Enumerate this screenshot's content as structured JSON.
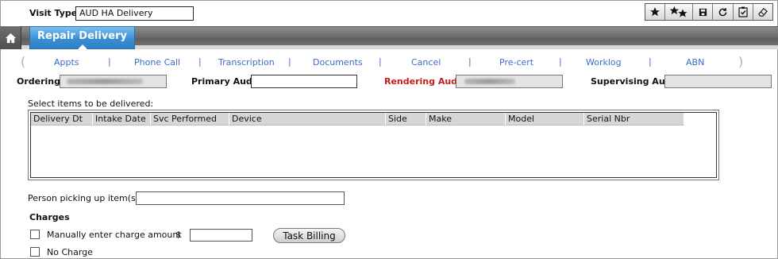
{
  "visit": {
    "type_label": "Visit Type:",
    "type_value": "AUD HA Delivery"
  },
  "toolbar": {
    "buttons": [
      {
        "icon": "star-icon"
      },
      {
        "icon": "two-stars-icon"
      },
      {
        "icon": "save-icon"
      },
      {
        "icon": "refresh-icon"
      },
      {
        "icon": "clipboard-check-icon"
      },
      {
        "icon": "eraser-icon"
      }
    ]
  },
  "header": {
    "active_tab": "Repair Delivery"
  },
  "nav": {
    "items": [
      "Appts",
      "Phone Call",
      "Transcription",
      "Documents",
      "Cancel",
      "Pre-cert",
      "Worklog",
      "ABN"
    ]
  },
  "aud": {
    "ordering_label": "Ordering:",
    "primary_label": "Primary Aud.:",
    "rendering_label": "Rendering Aud.:",
    "supervising_label": "Supervising Aud:"
  },
  "delivery": {
    "select_label": "Select items to be delivered:",
    "columns": [
      "Delivery Dt",
      "Intake Date",
      "Svc Performed",
      "Device",
      "Side",
      "Make",
      "Model",
      "Serial Nbr"
    ]
  },
  "pickup": {
    "label": "Person picking up item(s):"
  },
  "charges": {
    "heading": "Charges",
    "manual_label": "Manually enter charge amount",
    "currency": "$",
    "no_charge_label": "No Charge",
    "task_billing_label": "Task Billing"
  },
  "colors": {
    "accent": "#3a8fd5",
    "link": "#3b6cc9",
    "required_label": "#c41b1b"
  }
}
